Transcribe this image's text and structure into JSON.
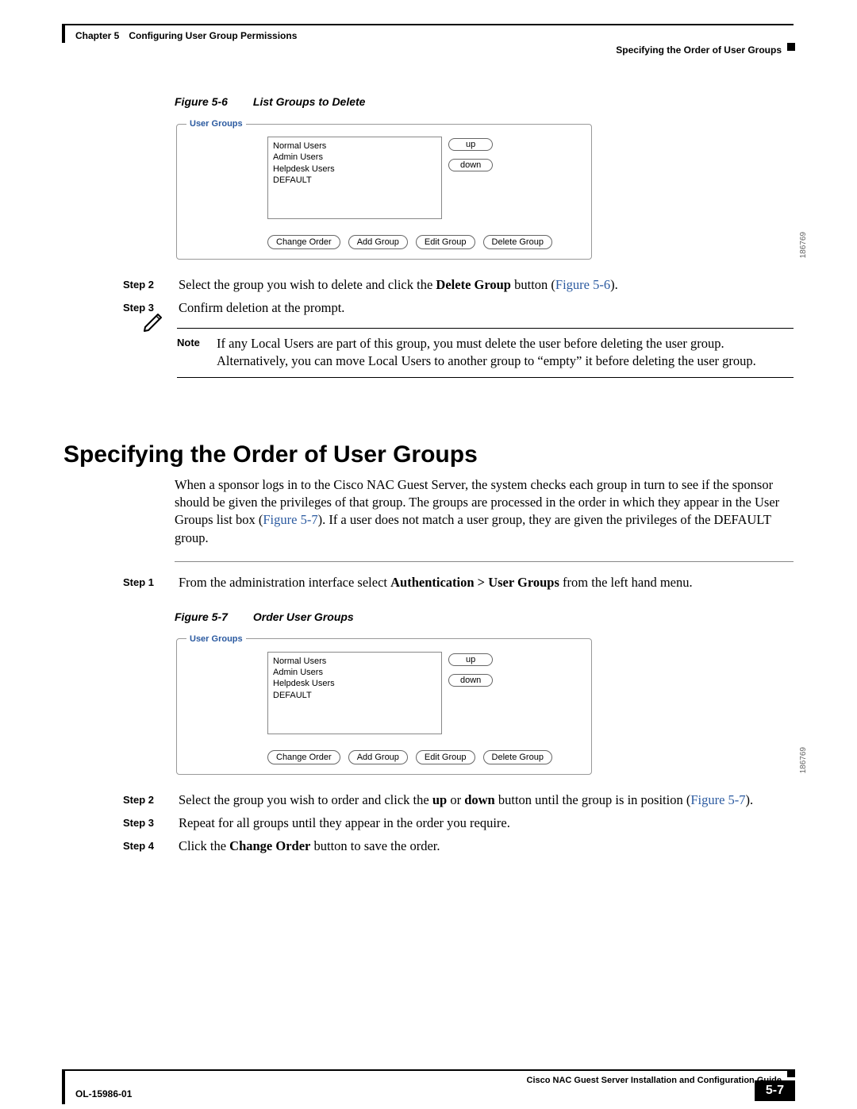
{
  "header": {
    "chapter": "Chapter 5 Configuring User Group Permissions",
    "section": "Specifying the Order of User Groups"
  },
  "figure6": {
    "label": "Figure 5-6",
    "title": "List Groups to Delete",
    "panel_title": "User Groups",
    "list": [
      "Normal Users",
      "Admin Users",
      "Helpdesk Users",
      "DEFAULT"
    ],
    "up": "up",
    "down": "down",
    "buttons": [
      "Change Order",
      "Add Group",
      "Edit Group",
      "Delete Group"
    ],
    "id": "186769"
  },
  "steps_a": {
    "s2_label": "Step 2",
    "s2_pre": "Select the group you wish to delete and click the ",
    "s2_bold": "Delete Group",
    "s2_mid": " button (",
    "s2_ref": "Figure 5-6",
    "s2_post": ").",
    "s3_label": "Step 3",
    "s3_text": "Confirm deletion at the prompt."
  },
  "note": {
    "label": "Note",
    "text": "If any Local Users are part of this group, you must delete the user before deleting the user group. Alternatively, you can move Local Users to another group to “empty” it before deleting the user group."
  },
  "heading": "Specifying the Order of User Groups",
  "para": {
    "pre": "When a sponsor logs in to the Cisco NAC Guest Server, the system checks each group in turn to see if the sponsor should be given the privileges of that group. The groups are processed in the order in which they appear in the User Groups list box (",
    "ref": "Figure 5-7",
    "post": "). If a user does not match a user group, they are given the privileges of the DEFAULT group."
  },
  "steps_b": {
    "s1_label": "Step 1",
    "s1_pre": "From the administration interface select ",
    "s1_bold": "Authentication > User Groups",
    "s1_post": " from the left hand menu."
  },
  "figure7": {
    "label": "Figure 5-7",
    "title": "Order User Groups",
    "panel_title": "User Groups",
    "list": [
      "Normal Users",
      "Admin Users",
      "Helpdesk Users",
      "DEFAULT"
    ],
    "up": "up",
    "down": "down",
    "buttons": [
      "Change Order",
      "Add Group",
      "Edit Group",
      "Delete Group"
    ],
    "id": "186769"
  },
  "steps_c": {
    "s2_label": "Step 2",
    "s2_pre": "Select the group you wish to order and click the ",
    "s2_b1": "up",
    "s2_mid1": " or ",
    "s2_b2": "down",
    "s2_mid2": " button until the group is in position (",
    "s2_ref": "Figure 5-7",
    "s2_post": ").",
    "s3_label": "Step 3",
    "s3_text": "Repeat for all groups until they appear in the order you require.",
    "s4_label": "Step 4",
    "s4_pre": "Click the ",
    "s4_bold": "Change Order",
    "s4_post": " button to save the order."
  },
  "footer": {
    "doc": "Cisco NAC Guest Server Installation and Configuration Guide",
    "ol": "OL-15986-01",
    "page": "5-7"
  }
}
